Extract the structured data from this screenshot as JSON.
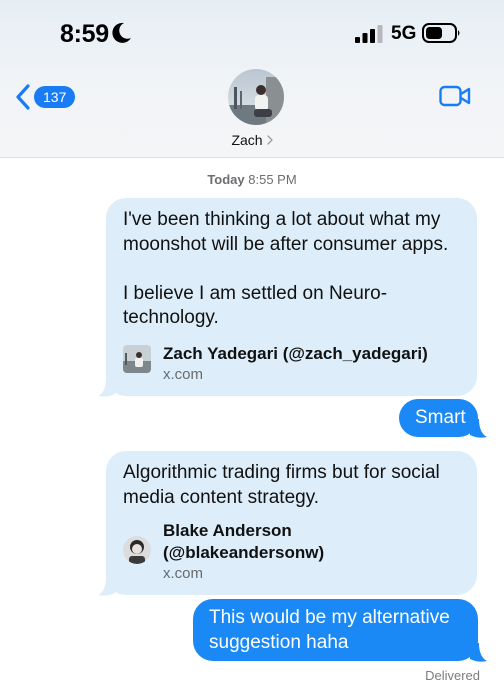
{
  "status_bar": {
    "time": "8:59",
    "network": "5G",
    "icons": [
      "moon-icon",
      "signal-icon",
      "battery-icon"
    ]
  },
  "nav": {
    "back_badge": "137",
    "contact_name": "Zach",
    "icons": [
      "chevron-left-icon",
      "facetime-video-icon",
      "chevron-right-icon"
    ]
  },
  "conversation": {
    "timestamp_day": "Today",
    "timestamp_time": "8:55 PM",
    "messages": [
      {
        "direction": "incoming",
        "text": "I've been thinking a lot about what my moonshot will be after consumer apps.\n\nI believe I am settled on Neuro-technology.",
        "link": {
          "title": "Zach Yadegari (@zach_yadegari)",
          "domain": "x.com"
        }
      },
      {
        "direction": "outgoing",
        "text": "Smart"
      },
      {
        "direction": "incoming",
        "text": "Algorithmic trading firms but for social media content strategy.",
        "link": {
          "title": "Blake Anderson\n(@blakeandersonw)",
          "domain": "x.com"
        }
      },
      {
        "direction": "outgoing",
        "text": "This would be my alternative suggestion haha"
      }
    ],
    "delivery_status": "Delivered"
  },
  "colors": {
    "accent_blue": "#1a88f5",
    "incoming_bubble": "#ddeefa",
    "badge_blue": "#1a7cf5"
  }
}
